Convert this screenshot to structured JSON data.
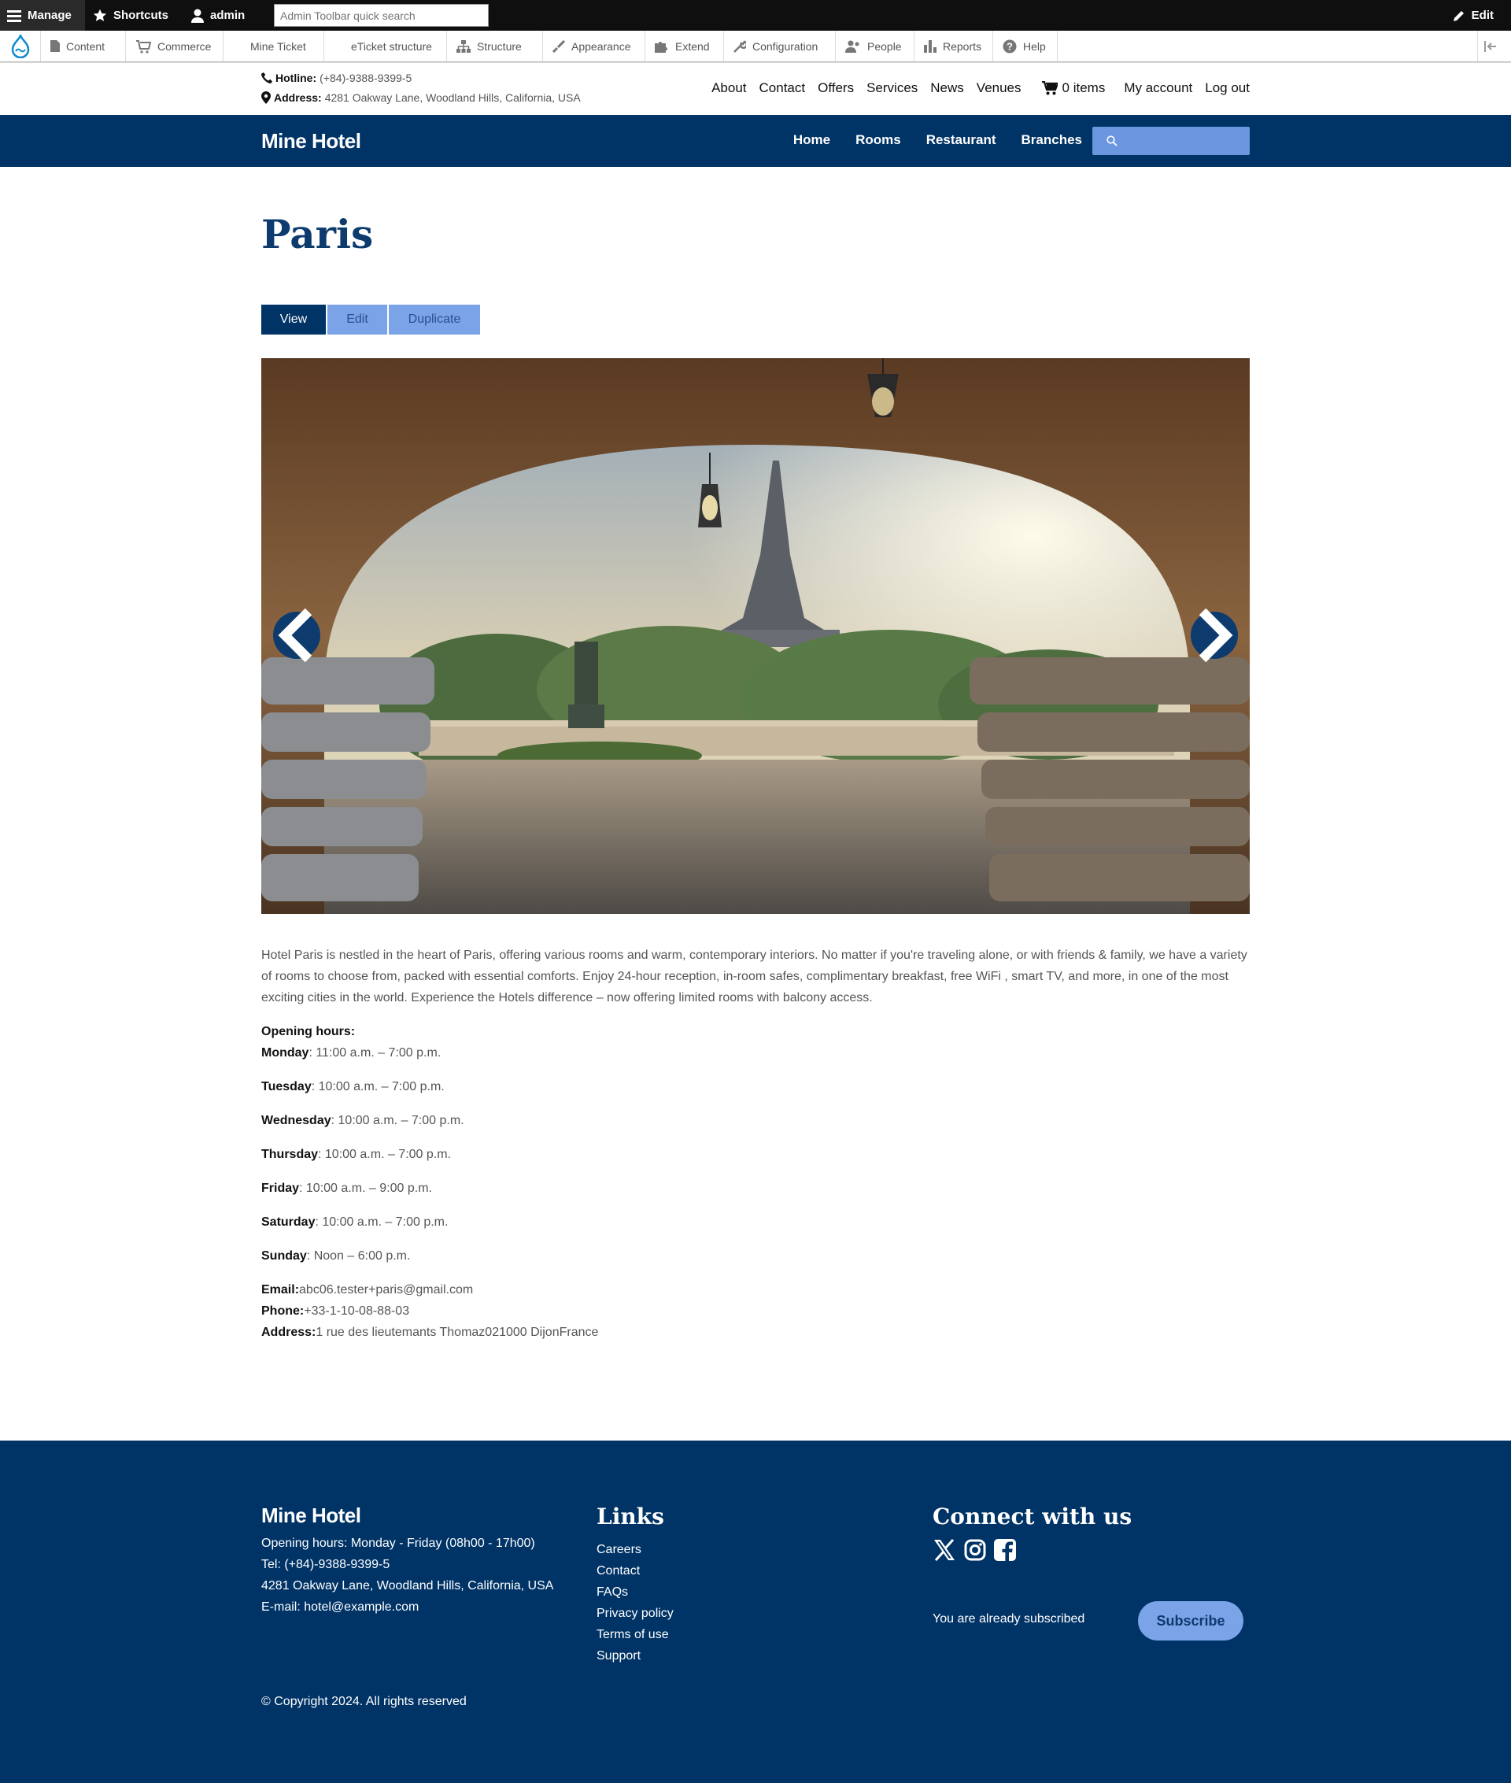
{
  "admin_toolbar": {
    "manage": "Manage",
    "shortcuts": "Shortcuts",
    "user": "admin",
    "search_placeholder": "Admin Toolbar quick search",
    "edit": "Edit",
    "tray": [
      "Content",
      "Commerce",
      "Mine Ticket",
      "eTicket structure",
      "Structure",
      "Appearance",
      "Extend",
      "Configuration",
      "People",
      "Reports",
      "Help"
    ]
  },
  "info": {
    "hotline_label": "Hotline:",
    "hotline": "(+84)-9388-9399-5",
    "address_label": "Address:",
    "address": "4281 Oakway Lane, Woodland Hills, California, USA"
  },
  "top_nav": {
    "about": "About",
    "contact": "Contact",
    "offers": "Offers",
    "services": "Services",
    "news": "News",
    "venues": "Venues",
    "cart": "0 items",
    "my_account": "My account",
    "logout": "Log out"
  },
  "header": {
    "brand": "Mine Hotel",
    "nav": [
      "Home",
      "Rooms",
      "Restaurant",
      "Branches"
    ]
  },
  "page": {
    "title": "Paris",
    "tabs": [
      "View",
      "Edit",
      "Duplicate"
    ],
    "description": "Hotel Paris is nestled in the heart of Paris, offering various rooms and warm, contemporary interiors. No matter if you're traveling alone, or with friends & family, we have a variety of rooms to choose from, packed with essential comforts. Enjoy 24-hour reception, in-room safes, complimentary breakfast, free WiFi , smart TV, and more, in one of the most exciting cities in the world. Experience the Hotels difference – now offering limited rooms with balcony access.",
    "hours_heading": "Opening hours:",
    "hours": [
      {
        "day": "Monday",
        "time": ": 11:00 a.m. – 7:00 p.m."
      },
      {
        "day": "Tuesday",
        "time": ": 10:00 a.m. – 7:00 p.m."
      },
      {
        "day": "Wednesday",
        "time": ": 10:00 a.m. – 7:00 p.m."
      },
      {
        "day": "Thursday",
        "time": ": 10:00 a.m. – 7:00 p.m."
      },
      {
        "day": "Friday",
        "time": ": 10:00 a.m. – 9:00 p.m."
      },
      {
        "day": "Saturday",
        "time": ": 10:00 a.m. – 7:00 p.m."
      },
      {
        "day": "Sunday",
        "time": ": Noon – 6:00 p.m."
      }
    ],
    "email_label": "Email:",
    "email": "abc06.tester+paris@gmail.com",
    "phone_label": "Phone:",
    "phone": "+33-1-10-08-88-03",
    "address_label": "Address:",
    "address": "1 rue des lieutemants Thomaz021000 DijonFrance"
  },
  "footer": {
    "brand": "Mine Hotel",
    "opening": "Opening hours: Monday - Friday (08h00 - 17h00)",
    "tel": "Tel: (+84)-9388-9399-5",
    "address": "4281 Oakway Lane, Woodland Hills, California, USA",
    "email": "E-mail: hotel@example.com",
    "links_heading": "Links",
    "links": [
      "Careers",
      "Contact",
      "FAQs",
      "Privacy policy",
      "Terms of use",
      "Support"
    ],
    "connect_heading": "Connect with us",
    "subscribed_text": "You are already subscribed",
    "subscribe_button": "Subscribe",
    "copyright": "© Copyright 2024. All rights reserved"
  },
  "colors": {
    "primary": "#003366",
    "accent": "#7ba3e8",
    "title": "#0d3b6e"
  }
}
